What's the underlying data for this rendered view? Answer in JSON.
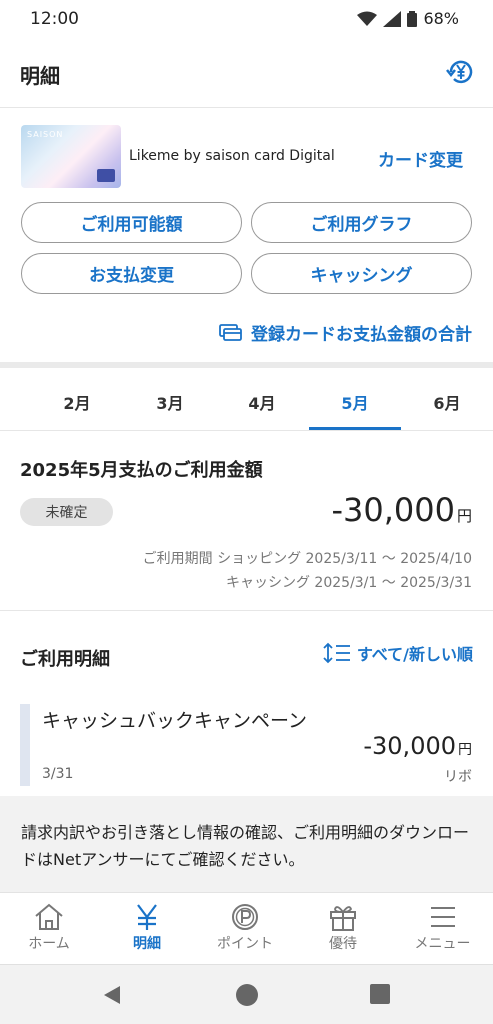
{
  "status_bar": {
    "time": "12:00",
    "battery": "68%"
  },
  "header": {
    "title": "明細"
  },
  "card": {
    "brand": "SAISON",
    "name": "Likeme by saison card Digital",
    "change_label": "カード変更"
  },
  "actions": {
    "available": "ご利用可能額",
    "graph": "ご利用グラフ",
    "payment_change": "お支払変更",
    "cashing": "キャッシング"
  },
  "total_link": "登録カードお支払金額の合計",
  "months": [
    "2月",
    "3月",
    "4月",
    "5月",
    "6月"
  ],
  "active_month": "5月",
  "summary": {
    "title": "2025年5月支払のご利用金額",
    "status": "未確定",
    "amount": "-30,000",
    "currency": "円",
    "period_line1": "ご利用期間 ショッピング 2025/3/11 〜 2025/4/10",
    "period_line2": "キャッシング 2025/3/1 〜 2025/3/31"
  },
  "details": {
    "title": "ご利用明細",
    "sort_label": "すべて/新しい順"
  },
  "transactions": [
    {
      "name": "キャッシュバックキャンペーン",
      "date": "3/31",
      "amount": "-30,000",
      "currency": "円",
      "type": "リボ"
    }
  ],
  "info_text": "請求内訳やお引き落とし情報の確認、ご利用明細のダウンロードはNetアンサーにてご確認ください。",
  "bottom_nav": {
    "home": "ホーム",
    "statement": "明細",
    "points": "ポイント",
    "benefits": "優待",
    "menu": "メニュー"
  },
  "colors": {
    "accent": "#1a73c8"
  }
}
